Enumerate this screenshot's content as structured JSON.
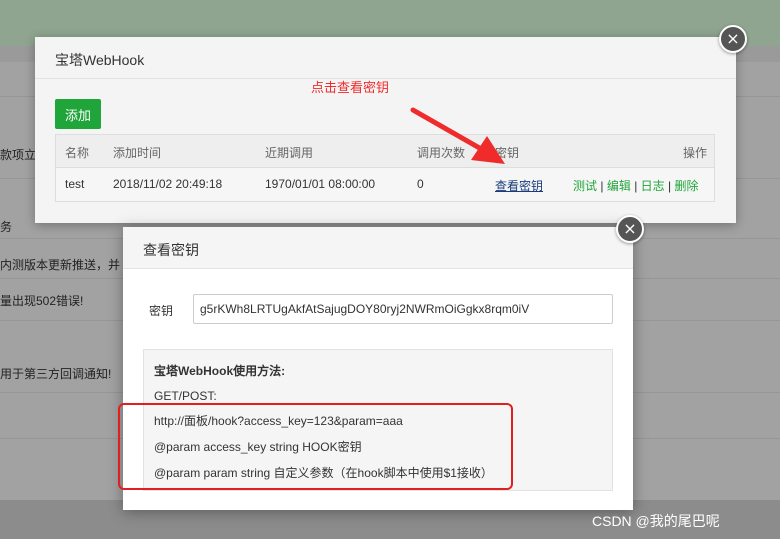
{
  "background": {
    "rows": [
      "款项立",
      "务",
      "内测版本更新推送，并",
      "量出现502错误!",
      "用于第三方回调通知!"
    ]
  },
  "webhook_dialog": {
    "title": "宝塔WebHook",
    "add_label": "添加",
    "columns": [
      "名称",
      "添加时间",
      "近期调用",
      "调用次数",
      "密钥",
      "操作"
    ],
    "rows": [
      {
        "name": "test",
        "added": "2018/11/02 20:49:18",
        "last_call": "1970/01/01 08:00:00",
        "count": "0",
        "key_link": "查看密钥",
        "ops": [
          "测试",
          "编辑",
          "日志",
          "删除"
        ]
      }
    ],
    "close": "×"
  },
  "annotation": {
    "text": "点击查看密钥",
    "color": "#ef2b2b"
  },
  "key_dialog": {
    "title": "查看密钥",
    "key_label": "密钥",
    "key_value": "g5rKWh8LRTUgAkfAtSajugDOY80ryj2NWRmOiGgkx8rqm0iV",
    "help_title": "宝塔WebHook使用方法:",
    "help_lines": [
      "GET/POST:",
      "http://面板/hook?access_key=123&param=aaa",
      "@param access_key string HOOK密钥",
      "@param param string 自定义参数（在hook脚本中使用$1接收）"
    ],
    "close": "×"
  },
  "watermark": "CSDN @我的尾巴呢",
  "colors": {
    "accent_green": "#20a53a",
    "highlight_red": "#e02020",
    "link_blue": "#1a3c7a"
  }
}
